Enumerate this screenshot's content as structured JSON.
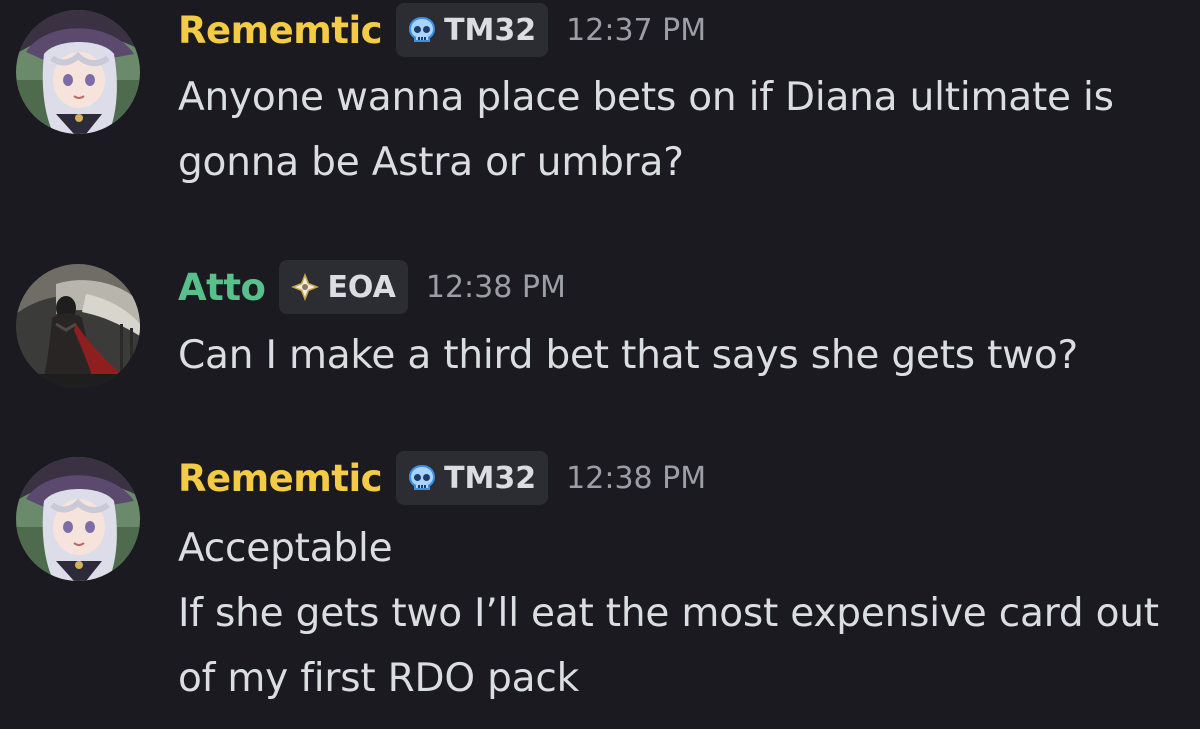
{
  "messages": [
    {
      "author": "Rememtic",
      "author_color": "#f4cb45",
      "tag": "TM32",
      "tag_icon": "skull-icon",
      "time": "12:37 PM",
      "lines": [
        "Anyone wanna place bets on if Diana ultimate is gonna be Astra or umbra?"
      ]
    },
    {
      "author": "Atto",
      "author_color": "#58c08a",
      "tag": "EOA",
      "tag_icon": "diamond-star-icon",
      "time": "12:38 PM",
      "lines": [
        "Can I make a third bet that says she gets two?"
      ]
    },
    {
      "author": "Rememtic",
      "author_color": "#f4cb45",
      "tag": "TM32",
      "tag_icon": "skull-icon",
      "time": "12:38 PM",
      "lines": [
        "Acceptable",
        "If she gets two I’ll eat the most expensive card out of my first RDO pack"
      ]
    }
  ]
}
